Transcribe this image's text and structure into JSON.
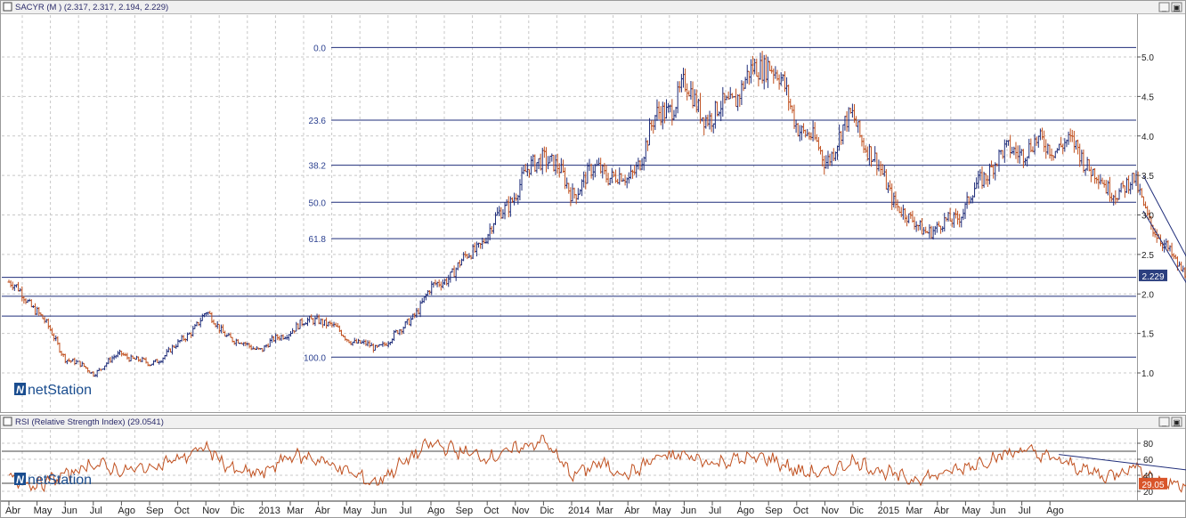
{
  "price_panel": {
    "title": "SACYR (M ) (2.317, 2.317, 2.194, 2.229)",
    "last_value": "2.229",
    "logo_text": "netStation"
  },
  "rsi_panel": {
    "title": "RSI (Relative Strength Index) (29.0541)",
    "last_value": "29.05",
    "logo_text": "netStation"
  },
  "window_buttons": {
    "minimize": "_",
    "restore": "▣"
  },
  "colors": {
    "up_bar": "#1f2d7a",
    "down_bar": "#c0501f",
    "rsi_line": "#c0501f",
    "fib_line": "#1f2d7a",
    "trend_line": "#1f2d7a",
    "last_price_badge": "#2b3f7f",
    "rsi_badge": "#d9552a",
    "grid": "#c8c8c8",
    "logo": "#1a4d8f"
  },
  "chart_data": [
    {
      "type": "ohlc",
      "series_name": "SACYR",
      "ohlc_latest": {
        "open": 2.317,
        "high": 2.317,
        "low": 2.194,
        "close": 2.229
      },
      "y_ticks": [
        1.0,
        1.5,
        2.0,
        2.5,
        3.0,
        3.5,
        4.0,
        4.5,
        5.0
      ],
      "ylim": [
        0.5,
        5.5
      ],
      "x_ticks": [
        "Abr",
        "May",
        "Jun",
        "Jul",
        "Ago",
        "Sep",
        "Oct",
        "Nov",
        "Dic",
        "2013",
        "Mar",
        "Abr",
        "May",
        "Jun",
        "Jul",
        "Ago",
        "Sep",
        "Oct",
        "Nov",
        "Dic",
        "2014",
        "Mar",
        "Abr",
        "May",
        "Jun",
        "Jul",
        "Ago",
        "Sep",
        "Oct",
        "Nov",
        "Dic",
        "2015",
        "Mar",
        "Abr",
        "May",
        "Jun",
        "Jul",
        "Ago"
      ],
      "anchors": [
        {
          "x": "Mar-2012",
          "y": 2.15
        },
        {
          "x": "Abr-2012",
          "y": 1.8
        },
        {
          "x": "May-2012",
          "y": 1.2
        },
        {
          "x": "Jun-2012",
          "y": 1.0
        },
        {
          "x": "Jul-2012",
          "y": 1.25
        },
        {
          "x": "Ago-2012",
          "y": 1.1
        },
        {
          "x": "Sep-2012",
          "y": 1.35
        },
        {
          "x": "Oct-2012",
          "y": 1.75
        },
        {
          "x": "Nov-2012",
          "y": 1.4
        },
        {
          "x": "Dic-2012",
          "y": 1.3
        },
        {
          "x": "Ene-2013",
          "y": 1.55
        },
        {
          "x": "Feb-2013",
          "y": 1.7
        },
        {
          "x": "Mar-2013",
          "y": 1.45
        },
        {
          "x": "Abr-2013",
          "y": 1.3
        },
        {
          "x": "May-2013",
          "y": 1.55
        },
        {
          "x": "Jun-2013",
          "y": 2.05
        },
        {
          "x": "Jul-2013",
          "y": 2.35
        },
        {
          "x": "Ago-2013",
          "y": 2.75
        },
        {
          "x": "Sep-2013",
          "y": 3.3
        },
        {
          "x": "Oct-2013",
          "y": 3.8
        },
        {
          "x": "Nov-2013",
          "y": 3.3
        },
        {
          "x": "Dic-2013",
          "y": 3.6
        },
        {
          "x": "Ene-2014",
          "y": 3.4
        },
        {
          "x": "Feb-2014",
          "y": 4.2
        },
        {
          "x": "Mar-2014",
          "y": 4.6
        },
        {
          "x": "Abr-2014",
          "y": 4.2
        },
        {
          "x": "May-2014",
          "y": 4.6
        },
        {
          "x": "Jun-2014",
          "y": 5.0
        },
        {
          "x": "Jul-2014",
          "y": 4.2
        },
        {
          "x": "Ago-2014",
          "y": 3.7
        },
        {
          "x": "Sep-2014",
          "y": 4.25
        },
        {
          "x": "Oct-2014",
          "y": 3.5
        },
        {
          "x": "Nov-2014",
          "y": 2.9
        },
        {
          "x": "Dic-2014",
          "y": 2.8
        },
        {
          "x": "Ene-2015",
          "y": 3.1
        },
        {
          "x": "Feb-2015",
          "y": 3.7
        },
        {
          "x": "Mar-2015",
          "y": 3.85
        },
        {
          "x": "Abr-2015",
          "y": 3.9
        },
        {
          "x": "May-2015",
          "y": 3.85
        },
        {
          "x": "Jun-2015",
          "y": 3.3
        },
        {
          "x": "Jul-2015",
          "y": 3.4
        },
        {
          "x": "Ago-2015",
          "y": 2.6
        },
        {
          "x": "Sep-2015",
          "y": 2.229
        }
      ],
      "fibonacci": [
        {
          "label": "0.0",
          "value": 5.12
        },
        {
          "label": "23.6",
          "value": 4.2
        },
        {
          "label": "38.2",
          "value": 3.63
        },
        {
          "label": "50.0",
          "value": 3.16
        },
        {
          "label": "61.8",
          "value": 2.7
        },
        {
          "label": "100.0",
          "value": 1.2
        }
      ],
      "horizontal_levels": [
        2.21,
        1.97,
        1.72
      ],
      "trend_channel": [
        {
          "from": {
            "x": "Jul-2015",
            "y": 3.5
          },
          "to": {
            "x": "Sep-2015",
            "y": 2.2
          }
        },
        {
          "from": {
            "x": "Jul-2015",
            "y": 3.05
          },
          "to": {
            "x": "Sep-2015",
            "y": 1.9
          }
        }
      ],
      "grid": true,
      "y_axis": "right"
    },
    {
      "type": "line",
      "series_name": "RSI (Relative Strength Index)",
      "last": 29.0541,
      "y_ticks": [
        20,
        40,
        60,
        80
      ],
      "ylim": [
        10,
        95
      ],
      "guide_levels": [
        70,
        30
      ],
      "anchors": [
        {
          "x": "Mar-2012",
          "y": 35
        },
        {
          "x": "Abr-2012",
          "y": 28
        },
        {
          "x": "May-2012",
          "y": 40
        },
        {
          "x": "Jun-2012",
          "y": 55
        },
        {
          "x": "Jul-2012",
          "y": 45
        },
        {
          "x": "Ago-2012",
          "y": 50
        },
        {
          "x": "Sep-2012",
          "y": 60
        },
        {
          "x": "Oct-2012",
          "y": 75
        },
        {
          "x": "Nov-2012",
          "y": 45
        },
        {
          "x": "Dic-2012",
          "y": 42
        },
        {
          "x": "Ene-2013",
          "y": 65
        },
        {
          "x": "Feb-2013",
          "y": 60
        },
        {
          "x": "Mar-2013",
          "y": 45
        },
        {
          "x": "Abr-2013",
          "y": 30
        },
        {
          "x": "May-2013",
          "y": 55
        },
        {
          "x": "Jun-2013",
          "y": 80
        },
        {
          "x": "Jul-2013",
          "y": 70
        },
        {
          "x": "Ago-2013",
          "y": 62
        },
        {
          "x": "Sep-2013",
          "y": 72
        },
        {
          "x": "Oct-2013",
          "y": 85
        },
        {
          "x": "Nov-2013",
          "y": 40
        },
        {
          "x": "Dic-2013",
          "y": 55
        },
        {
          "x": "Ene-2014",
          "y": 40
        },
        {
          "x": "Feb-2014",
          "y": 62
        },
        {
          "x": "Mar-2014",
          "y": 65
        },
        {
          "x": "Abr-2014",
          "y": 55
        },
        {
          "x": "May-2014",
          "y": 60
        },
        {
          "x": "Jun-2014",
          "y": 62
        },
        {
          "x": "Jul-2014",
          "y": 45
        },
        {
          "x": "Ago-2014",
          "y": 42
        },
        {
          "x": "Sep-2014",
          "y": 58
        },
        {
          "x": "Oct-2014",
          "y": 45
        },
        {
          "x": "Nov-2014",
          "y": 35
        },
        {
          "x": "Dic-2014",
          "y": 40
        },
        {
          "x": "Ene-2015",
          "y": 50
        },
        {
          "x": "Feb-2015",
          "y": 62
        },
        {
          "x": "Mar-2015",
          "y": 72
        },
        {
          "x": "Abr-2015",
          "y": 62
        },
        {
          "x": "May-2015",
          "y": 50
        },
        {
          "x": "Jun-2015",
          "y": 38
        },
        {
          "x": "Jul-2015",
          "y": 52
        },
        {
          "x": "Ago-2015",
          "y": 30
        },
        {
          "x": "Sep-2015",
          "y": 29
        }
      ],
      "trend_line": {
        "from": {
          "x": "Abr-2015",
          "y": 66
        },
        "to": {
          "x": "Sep-2015",
          "y": 45
        }
      },
      "grid": true,
      "y_axis": "right"
    }
  ]
}
